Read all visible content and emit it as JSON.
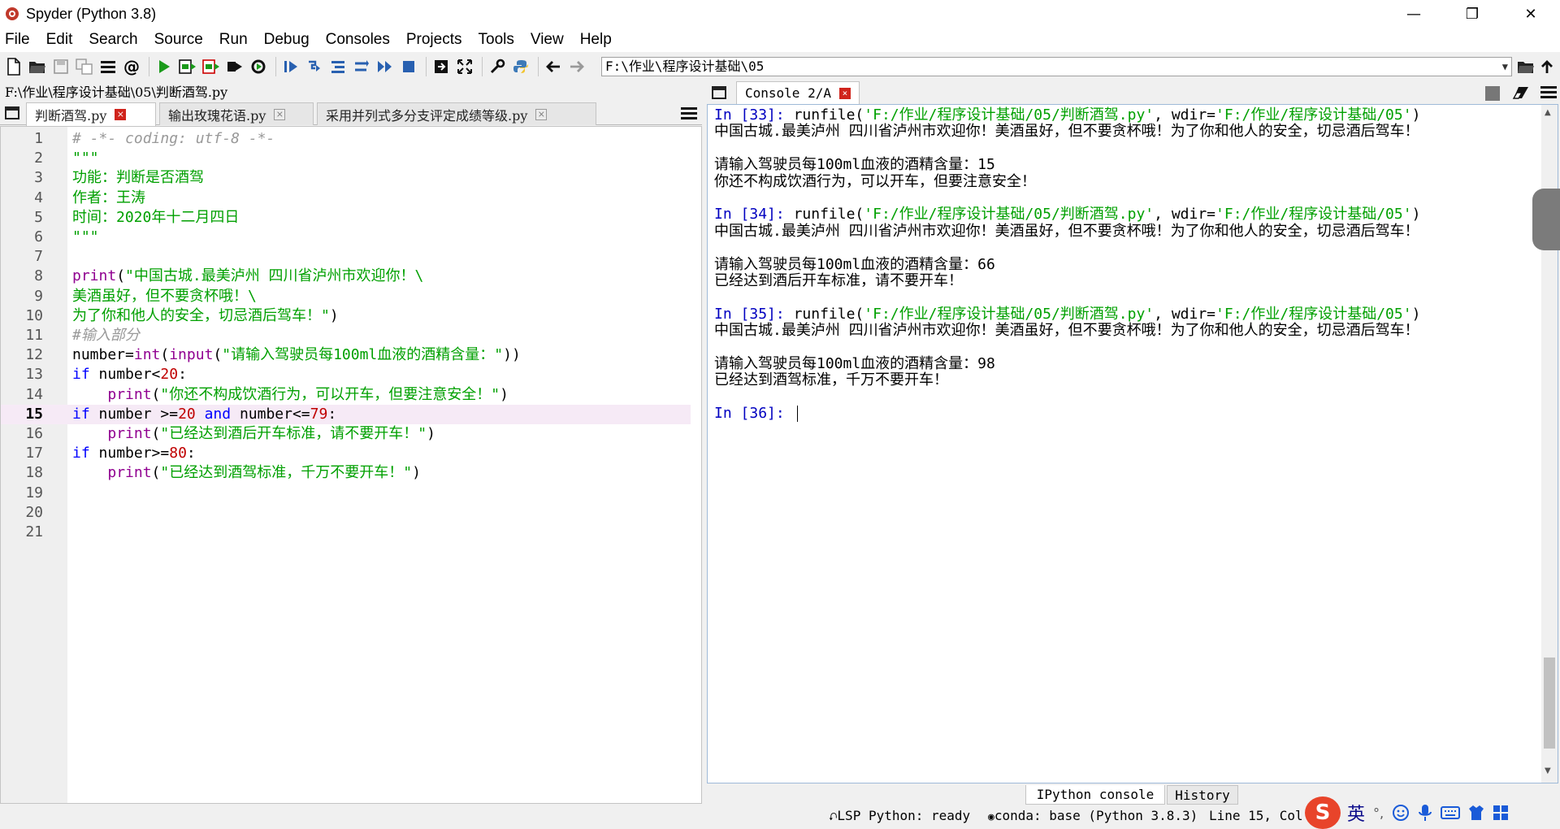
{
  "window": {
    "title": "Spyder (Python 3.8)"
  },
  "window_controls": [
    "—",
    "❐",
    "✕"
  ],
  "menu": [
    "File",
    "Edit",
    "Search",
    "Source",
    "Run",
    "Debug",
    "Consoles",
    "Projects",
    "Tools",
    "View",
    "Help"
  ],
  "toolbar": {
    "working_dir": "F:\\作业\\程序设计基础\\05"
  },
  "editor": {
    "file_path": "F:\\作业\\程序设计基础\\05\\判断酒驾.py",
    "tabs": [
      {
        "label": "判断酒驾.py",
        "active": true
      },
      {
        "label": "输出玫瑰花语.py",
        "active": false
      },
      {
        "label": "采用并列式多分支评定成绩等级.py",
        "active": false
      }
    ],
    "tab_close": "×",
    "line_numbers": [
      "1",
      "2",
      "3",
      "4",
      "5",
      "6",
      "7",
      "8",
      "9",
      "10",
      "11",
      "12",
      "13",
      "14",
      "15",
      "16",
      "17",
      "18",
      "19",
      "20",
      "21"
    ],
    "current_line": 15,
    "lines": [
      [
        [
          "cm",
          "# -*- coding: utf-8 -*-"
        ]
      ],
      [
        [
          "st",
          "\"\"\""
        ]
      ],
      [
        [
          "st",
          "功能：判断是否酒驾"
        ]
      ],
      [
        [
          "st",
          "作者：王涛"
        ]
      ],
      [
        [
          "st",
          "时间：2020年十二月四日"
        ]
      ],
      [
        [
          "st",
          "\"\"\""
        ]
      ],
      [],
      [
        [
          "bi",
          "print"
        ],
        [
          "tx",
          "("
        ],
        [
          "st",
          "\"中国古城.最美泸州 四川省泸州市欢迎你！\\"
        ]
      ],
      [
        [
          "st",
          "美酒虽好，但不要贪杯哦！\\"
        ]
      ],
      [
        [
          "st",
          "为了你和他人的安全，切忌酒后驾车！\""
        ],
        [
          "tx",
          ")"
        ]
      ],
      [
        [
          "cm",
          "#输入部分"
        ]
      ],
      [
        [
          "tx",
          "number="
        ],
        [
          "bi",
          "int"
        ],
        [
          "tx",
          "("
        ],
        [
          "bi",
          "input"
        ],
        [
          "tx",
          "("
        ],
        [
          "st",
          "\"请输入驾驶员每100ml血液的酒精含量：\""
        ],
        [
          "tx",
          "))"
        ]
      ],
      [
        [
          "kw",
          "if"
        ],
        [
          "tx",
          " number<"
        ],
        [
          "nm",
          "20"
        ],
        [
          "tx",
          ":"
        ]
      ],
      [
        [
          "tx",
          "    "
        ],
        [
          "bi",
          "print"
        ],
        [
          "tx",
          "("
        ],
        [
          "st",
          "\"你还不构成饮酒行为，可以开车，但要注意安全！\""
        ],
        [
          "tx",
          ")"
        ]
      ],
      [
        [
          "kw",
          "if"
        ],
        [
          "tx",
          " number >="
        ],
        [
          "nm",
          "20"
        ],
        [
          "tx",
          " "
        ],
        [
          "kw",
          "and"
        ],
        [
          "tx",
          " number<="
        ],
        [
          "nm",
          "79"
        ],
        [
          "tx",
          ":"
        ]
      ],
      [
        [
          "tx",
          "    "
        ],
        [
          "bi",
          "print"
        ],
        [
          "tx",
          "("
        ],
        [
          "st",
          "\"已经达到酒后开车标准，请不要开车！\""
        ],
        [
          "tx",
          ")"
        ]
      ],
      [
        [
          "kw",
          "if"
        ],
        [
          "tx",
          " number>="
        ],
        [
          "nm",
          "80"
        ],
        [
          "tx",
          ":"
        ]
      ],
      [
        [
          "tx",
          "    "
        ],
        [
          "bi",
          "print"
        ],
        [
          "tx",
          "("
        ],
        [
          "st",
          "\"已经达到酒驾标准，千万不要开车！\""
        ],
        [
          "tx",
          ")"
        ]
      ],
      [],
      [],
      []
    ]
  },
  "console": {
    "tab_label": "Console 2/A",
    "lines": [
      [
        [
          "in",
          "In ["
        ],
        [
          "num",
          "33"
        ],
        [
          "in",
          "]: "
        ],
        [
          "plain",
          "runfile("
        ],
        [
          "cstr",
          "'F:/作业/程序设计基础/05/判断酒驾.py'"
        ],
        [
          "plain",
          ", wdir="
        ],
        [
          "cstr",
          "'F:/作业/程序设计基础/05'"
        ],
        [
          "plain",
          ")"
        ]
      ],
      [
        [
          "plain",
          "中国古城.最美泸州 四川省泸州市欢迎你！美酒虽好，但不要贪杯哦！为了你和他人的安全，切忌酒后驾车！"
        ]
      ],
      [],
      [
        [
          "plain",
          "请输入驾驶员每100ml血液的酒精含量：15"
        ]
      ],
      [
        [
          "plain",
          "你还不构成饮酒行为，可以开车，但要注意安全！"
        ]
      ],
      [],
      [
        [
          "in",
          "In ["
        ],
        [
          "num",
          "34"
        ],
        [
          "in",
          "]: "
        ],
        [
          "plain",
          "runfile("
        ],
        [
          "cstr",
          "'F:/作业/程序设计基础/05/判断酒驾.py'"
        ],
        [
          "plain",
          ", wdir="
        ],
        [
          "cstr",
          "'F:/作业/程序设计基础/05'"
        ],
        [
          "plain",
          ")"
        ]
      ],
      [
        [
          "plain",
          "中国古城.最美泸州 四川省泸州市欢迎你！美酒虽好，但不要贪杯哦！为了你和他人的安全，切忌酒后驾车！"
        ]
      ],
      [],
      [
        [
          "plain",
          "请输入驾驶员每100ml血液的酒精含量：66"
        ]
      ],
      [
        [
          "plain",
          "已经达到酒后开车标准，请不要开车！"
        ]
      ],
      [],
      [
        [
          "in",
          "In ["
        ],
        [
          "num",
          "35"
        ],
        [
          "in",
          "]: "
        ],
        [
          "plain",
          "runfile("
        ],
        [
          "cstr",
          "'F:/作业/程序设计基础/05/判断酒驾.py'"
        ],
        [
          "plain",
          ", wdir="
        ],
        [
          "cstr",
          "'F:/作业/程序设计基础/05'"
        ],
        [
          "plain",
          ")"
        ]
      ],
      [
        [
          "plain",
          "中国古城.最美泸州 四川省泸州市欢迎你！美酒虽好，但不要贪杯哦！为了你和他人的安全，切忌酒后驾车！"
        ]
      ],
      [],
      [
        [
          "plain",
          "请输入驾驶员每100ml血液的酒精含量：98"
        ]
      ],
      [
        [
          "plain",
          "已经达到酒驾标准，千万不要开车！"
        ]
      ],
      [],
      [
        [
          "in",
          "In ["
        ],
        [
          "num",
          "36"
        ],
        [
          "in",
          "]: "
        ]
      ]
    ]
  },
  "bottom_tabs": [
    {
      "label": "IPython console",
      "active": true
    },
    {
      "label": "History",
      "active": false
    }
  ],
  "status": {
    "lsp": "LSP Python: ready",
    "conda": "conda: base (Python 3.8.3)",
    "position": "Line 15, Col 3"
  },
  "ime": {
    "lang_char": "英"
  },
  "colors": {
    "comment": "#999999",
    "string": "#00a000",
    "builtin": "#900090",
    "keyword": "#0000ff",
    "number": "#c00000",
    "console_prompt": "#0000c0",
    "current_line_bg": "#f6eaf6",
    "run_green": "#1a9a1a",
    "close_red": "#d0241c"
  }
}
